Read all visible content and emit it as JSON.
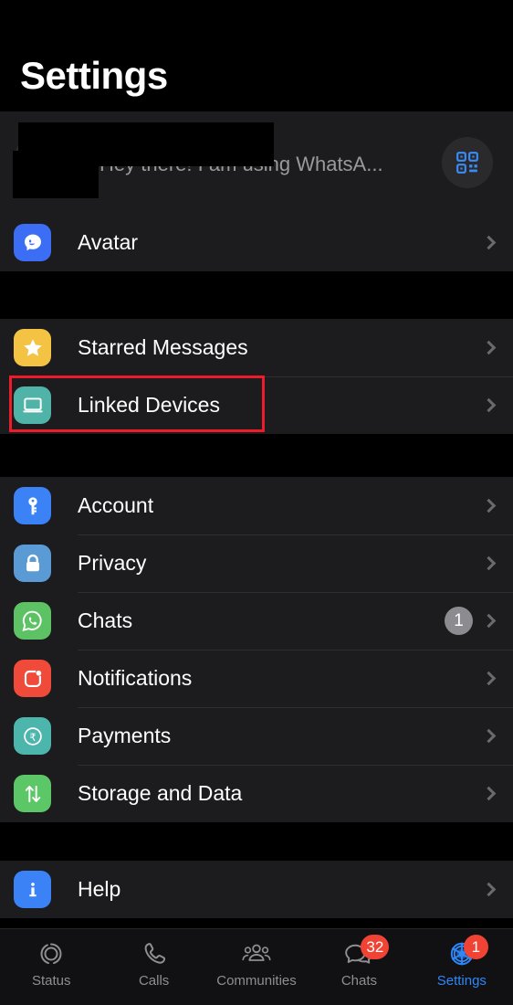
{
  "header": {
    "title": "Settings"
  },
  "profile": {
    "name": "",
    "status": "Hey there! I am using WhatsA...",
    "qr_icon": "qr-code-icon",
    "redacted": true
  },
  "colors": {
    "accent_blue": "#2f86f6",
    "badge_red": "#f04334",
    "highlight_red": "#ee1b2b",
    "row_bg": "#1c1c1e",
    "page_bg": "#000000"
  },
  "sections": [
    {
      "rows": [
        {
          "label": "Avatar",
          "icon": "avatar-icon",
          "icon_color": "#3b6ef5",
          "badge": "",
          "highlighted": false
        }
      ]
    },
    {
      "rows": [
        {
          "label": "Starred Messages",
          "icon": "star-icon",
          "icon_color": "#f5c344",
          "badge": "",
          "highlighted": false
        },
        {
          "label": "Linked Devices",
          "icon": "laptop-icon",
          "icon_color": "#4fb3a8",
          "badge": "",
          "highlighted": true
        }
      ]
    },
    {
      "rows": [
        {
          "label": "Account",
          "icon": "key-icon",
          "icon_color": "#3b82f6",
          "badge": "",
          "highlighted": false
        },
        {
          "label": "Privacy",
          "icon": "lock-icon",
          "icon_color": "#5b9bd5",
          "badge": "",
          "highlighted": false
        },
        {
          "label": "Chats",
          "icon": "whatsapp-icon",
          "icon_color": "#5dc264",
          "badge": "1",
          "highlighted": false
        },
        {
          "label": "Notifications",
          "icon": "notification-icon",
          "icon_color": "#ef4a3a",
          "badge": "",
          "highlighted": false
        },
        {
          "label": "Payments",
          "icon": "rupee-icon",
          "icon_color": "#4db6ac",
          "badge": "",
          "highlighted": false
        },
        {
          "label": "Storage and Data",
          "icon": "arrows-updown-icon",
          "icon_color": "#5cc766",
          "badge": "",
          "highlighted": false
        }
      ]
    },
    {
      "rows": [
        {
          "label": "Help",
          "icon": "info-icon",
          "icon_color": "#3b82f6",
          "badge": "",
          "highlighted": false
        }
      ]
    }
  ],
  "tabs": [
    {
      "label": "Status",
      "icon": "status-rings-icon",
      "badge": "",
      "active": false
    },
    {
      "label": "Calls",
      "icon": "phone-icon",
      "badge": "",
      "active": false
    },
    {
      "label": "Communities",
      "icon": "communities-icon",
      "badge": "",
      "active": false
    },
    {
      "label": "Chats",
      "icon": "chat-bubbles-icon",
      "badge": "32",
      "active": false
    },
    {
      "label": "Settings",
      "icon": "gear-icon",
      "badge": "1",
      "active": true
    }
  ]
}
